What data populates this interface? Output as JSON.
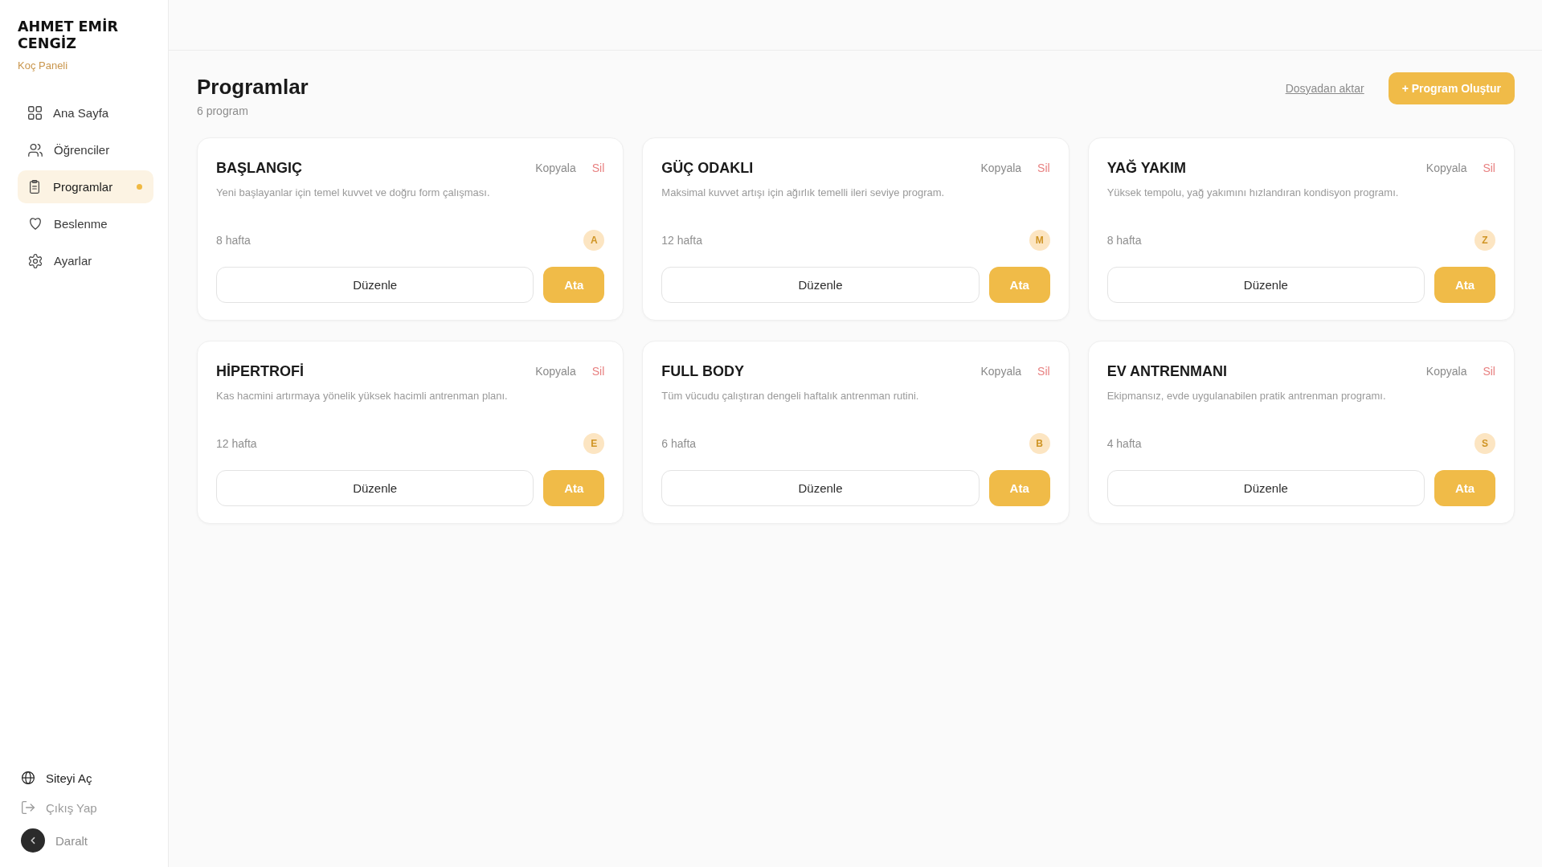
{
  "sidebar": {
    "brand": "AHMET EMİR CENGİZ",
    "subtitle": "Koç Paneli",
    "nav": [
      {
        "label": "Ana Sayfa",
        "kind": "dashboard",
        "selected": false
      },
      {
        "label": "Öğrenciler",
        "kind": "students",
        "selected": false
      },
      {
        "label": "Programlar",
        "kind": "programs",
        "selected": true
      },
      {
        "label": "Beslenme",
        "kind": "nutrition",
        "selected": false
      },
      {
        "label": "Ayarlar",
        "kind": "settings",
        "selected": false
      }
    ],
    "footer": [
      {
        "label": "Siteyi Aç",
        "kind": "site"
      },
      {
        "label": "Çıkış Yap",
        "kind": "logout"
      }
    ],
    "collapse": {
      "label": "Daralt"
    }
  },
  "header": {
    "title": "Programlar",
    "count": "6 program",
    "import_link": "Dosyadan aktar",
    "create_button": "+ Program Oluştur"
  },
  "programs": [
    {
      "name": "BAŞLANGIÇ",
      "description": "Yeni başlayanlar için temel kuvvet ve doğru form çalışması.",
      "duration": "8 hafta",
      "initial": "A",
      "copy_label": "Kopyala",
      "delete_label": "Sil",
      "edit_label": "Düzenle",
      "assign_label": "Ata"
    },
    {
      "name": "GÜÇ ODAKLI",
      "description": "Maksimal kuvvet artışı için ağırlık temelli ileri seviye program.",
      "duration": "12 hafta",
      "initial": "M",
      "copy_label": "Kopyala",
      "delete_label": "Sil",
      "edit_label": "Düzenle",
      "assign_label": "Ata"
    },
    {
      "name": "YAĞ YAKIM",
      "description": "Yüksek tempolu, yağ yakımını hızlandıran kondisyon programı.",
      "duration": "8 hafta",
      "initial": "Z",
      "copy_label": "Kopyala",
      "delete_label": "Sil",
      "edit_label": "Düzenle",
      "assign_label": "Ata"
    },
    {
      "name": "HİPERTROFİ",
      "description": "Kas hacmini artırmaya yönelik yüksek hacimli antrenman planı.",
      "duration": "12 hafta",
      "initial": "E",
      "copy_label": "Kopyala",
      "delete_label": "Sil",
      "edit_label": "Düzenle",
      "assign_label": "Ata"
    },
    {
      "name": "FULL BODY",
      "description": "Tüm vücudu çalıştıran dengeli haftalık antrenman rutini.",
      "duration": "6 hafta",
      "initial": "B",
      "copy_label": "Kopyala",
      "delete_label": "Sil",
      "edit_label": "Düzenle",
      "assign_label": "Ata"
    },
    {
      "name": "EV ANTRENMANI",
      "description": "Ekipmansız, evde uygulanabilen pratik antrenman programı.",
      "duration": "4 hafta",
      "initial": "S",
      "copy_label": "Kopyala",
      "delete_label": "Sil",
      "edit_label": "Düzenle",
      "assign_label": "Ata"
    }
  ]
}
